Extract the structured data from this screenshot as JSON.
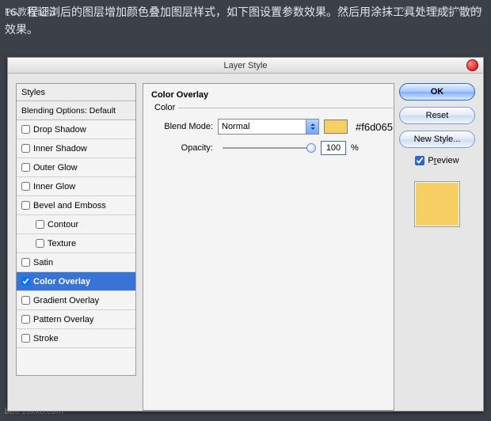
{
  "description": "16、程证浏后的图层增加颜色叠加图层样式，如下图设置参数效果。然后用涂抹工具处理成扩散的效果。",
  "watermarks": {
    "left": "PS教程论坛",
    "right": "www.missyuan.com",
    "bottom": "bbs.16xx8.com"
  },
  "dialog": {
    "title": "Layer Style",
    "stylesHeader": "Styles",
    "blendingOptions": "Blending Options: Default",
    "styles": [
      {
        "label": "Drop Shadow",
        "checked": false
      },
      {
        "label": "Inner Shadow",
        "checked": false
      },
      {
        "label": "Outer Glow",
        "checked": false
      },
      {
        "label": "Inner Glow",
        "checked": false
      },
      {
        "label": "Bevel and Emboss",
        "checked": false
      },
      {
        "label": "Contour",
        "checked": false,
        "indent": true
      },
      {
        "label": "Texture",
        "checked": false,
        "indent": true
      },
      {
        "label": "Satin",
        "checked": false
      },
      {
        "label": "Color Overlay",
        "checked": true,
        "selected": true,
        "bold": true
      },
      {
        "label": "Gradient Overlay",
        "checked": false
      },
      {
        "label": "Pattern Overlay",
        "checked": false
      },
      {
        "label": "Stroke",
        "checked": false
      }
    ],
    "main": {
      "sectionTitle": "Color Overlay",
      "subTitle": "Color",
      "blendModeLabel": "Blend Mode:",
      "blendModeValue": "Normal",
      "colorHex": "#f6d065",
      "opacityLabel": "Opacity:",
      "opacityValue": "100",
      "opacityUnit": "%"
    },
    "buttons": {
      "ok": "OK",
      "reset": "Reset",
      "newStyle": "New Style..."
    },
    "preview": {
      "label": "Preview",
      "checked": true
    }
  }
}
